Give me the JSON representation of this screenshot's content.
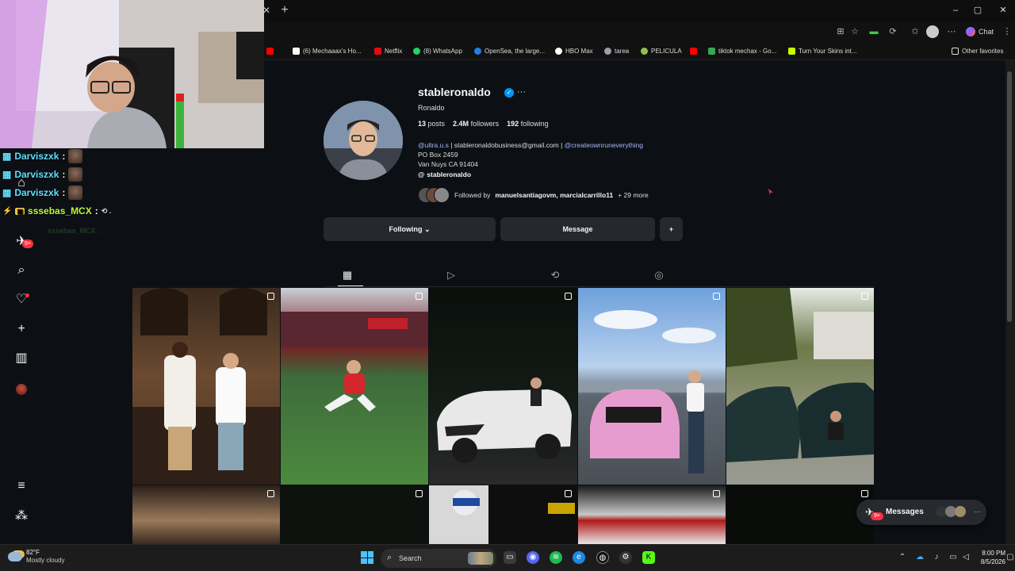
{
  "browser": {
    "window_controls": {
      "minimize": "–",
      "maximize": "▢",
      "close": "✕"
    },
    "copilot_label": "Chat",
    "bookmarks": [
      {
        "label": "(6) Mechaaax's Ho...",
        "color": "#ffffff"
      },
      {
        "label": "Netflix",
        "color": "#e50914"
      },
      {
        "label": "(8) WhatsApp",
        "color": "#25d366"
      },
      {
        "label": "OpenSea, the large...",
        "color": "#2081e2"
      },
      {
        "label": "HBO Max",
        "color": "#ffffff"
      },
      {
        "label": "tarea",
        "color": "#9aa0a6"
      },
      {
        "label": "PELICULA",
        "color": "#8bc34a"
      },
      {
        "label": "tiktok mechax - Go...",
        "color": "#34a853"
      },
      {
        "label": "Turn Your Skins int...",
        "color": "#c6ff00"
      }
    ],
    "other_favorites": "Other favorites"
  },
  "chat": [
    {
      "user": "Darviszxk",
      "suffix": ":",
      "color": "#5ee0ff"
    },
    {
      "user": "Darviszxk",
      "suffix": ":",
      "color": "#5ee0ff"
    },
    {
      "user": "Darviszxk",
      "suffix": ":",
      "color": "#5ee0ff"
    },
    {
      "user": "sssebas_MCX",
      "suffix": ":",
      "color": "#b8ff3c"
    }
  ],
  "chat_ghost": "sssebas_MCX :",
  "sidebar": {
    "notif_badge": "9+"
  },
  "profile": {
    "username": "stableronaldo",
    "verified_mark": "✓",
    "full_name": "Ronaldo",
    "posts_count": "13",
    "posts_label": "posts",
    "followers_count": "2.4M",
    "followers_label": "followers",
    "following_count": "192",
    "following_label": "following",
    "bio_link1": "@ultra.u.s",
    "bio_sep1": " | stableronaldobusiness@gmail.com | ",
    "bio_link2": "@createownruneverything",
    "bio_line2": "PO Box 2459",
    "bio_line3": "Van Nuys CA 91404",
    "threads_handle": "stableronaldo",
    "followed_by_prefix": "Followed by",
    "followed_by_names": "manuelsantiagovm, marcialcarrillo11",
    "followed_by_more": "+ 29 more",
    "following_button": "Following",
    "message_button": "Message"
  },
  "messages_pill": {
    "label": "Messages",
    "badge": "9+"
  },
  "taskbar": {
    "weather_temp": "82°F",
    "weather_desc": "Mostly cloudy",
    "search_label": "Search",
    "time": "8:00 PM",
    "date": "8/5/2026"
  },
  "colors": {
    "page_bg": "#0c1014",
    "link": "#a5b4fc",
    "verified": "#0095f6",
    "badge": "#ff3040"
  }
}
